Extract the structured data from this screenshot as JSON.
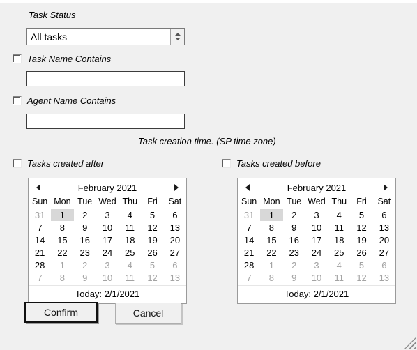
{
  "form": {
    "task_status_label": "Task Status",
    "task_status_value": "All tasks",
    "task_name_label": "Task Name Contains",
    "task_name_value": "",
    "agent_name_label": "Agent Name Contains",
    "agent_name_value": "",
    "creation_time_note": "Task creation time. (SP time zone)",
    "created_after_label": "Tasks created after",
    "created_before_label": "Tasks created before"
  },
  "calendar": {
    "title": "February 2021",
    "prev_icon": "triangle-left-icon",
    "next_icon": "triangle-right-icon",
    "weekdays": [
      "Sun",
      "Mon",
      "Tue",
      "Wed",
      "Thu",
      "Fri",
      "Sat"
    ],
    "footer": "Today: 2/1/2021",
    "today_cell": {
      "row": 0,
      "col": 1
    },
    "highlight_color": "#d8d8d8",
    "adjacent_color": "#a3a3a3",
    "weeks": [
      [
        {
          "d": "31",
          "adj": true
        },
        {
          "d": "1",
          "adj": false
        },
        {
          "d": "2",
          "adj": false
        },
        {
          "d": "3",
          "adj": false
        },
        {
          "d": "4",
          "adj": false
        },
        {
          "d": "5",
          "adj": false
        },
        {
          "d": "6",
          "adj": false
        }
      ],
      [
        {
          "d": "7",
          "adj": false
        },
        {
          "d": "8",
          "adj": false
        },
        {
          "d": "9",
          "adj": false
        },
        {
          "d": "10",
          "adj": false
        },
        {
          "d": "11",
          "adj": false
        },
        {
          "d": "12",
          "adj": false
        },
        {
          "d": "13",
          "adj": false
        }
      ],
      [
        {
          "d": "14",
          "adj": false
        },
        {
          "d": "15",
          "adj": false
        },
        {
          "d": "16",
          "adj": false
        },
        {
          "d": "17",
          "adj": false
        },
        {
          "d": "18",
          "adj": false
        },
        {
          "d": "19",
          "adj": false
        },
        {
          "d": "20",
          "adj": false
        }
      ],
      [
        {
          "d": "21",
          "adj": false
        },
        {
          "d": "22",
          "adj": false
        },
        {
          "d": "23",
          "adj": false
        },
        {
          "d": "24",
          "adj": false
        },
        {
          "d": "25",
          "adj": false
        },
        {
          "d": "26",
          "adj": false
        },
        {
          "d": "27",
          "adj": false
        }
      ],
      [
        {
          "d": "28",
          "adj": false
        },
        {
          "d": "1",
          "adj": true
        },
        {
          "d": "2",
          "adj": true
        },
        {
          "d": "3",
          "adj": true
        },
        {
          "d": "4",
          "adj": true
        },
        {
          "d": "5",
          "adj": true
        },
        {
          "d": "6",
          "adj": true
        }
      ],
      [
        {
          "d": "7",
          "adj": true
        },
        {
          "d": "8",
          "adj": true
        },
        {
          "d": "9",
          "adj": true
        },
        {
          "d": "10",
          "adj": true
        },
        {
          "d": "11",
          "adj": true
        },
        {
          "d": "12",
          "adj": true
        },
        {
          "d": "13",
          "adj": true
        }
      ]
    ]
  },
  "buttons": {
    "confirm_label": "Confirm",
    "cancel_label": "Cancel"
  },
  "colors": {
    "window_background": "#f0f0f0",
    "field_background": "#ffffff",
    "text": "#000000"
  }
}
